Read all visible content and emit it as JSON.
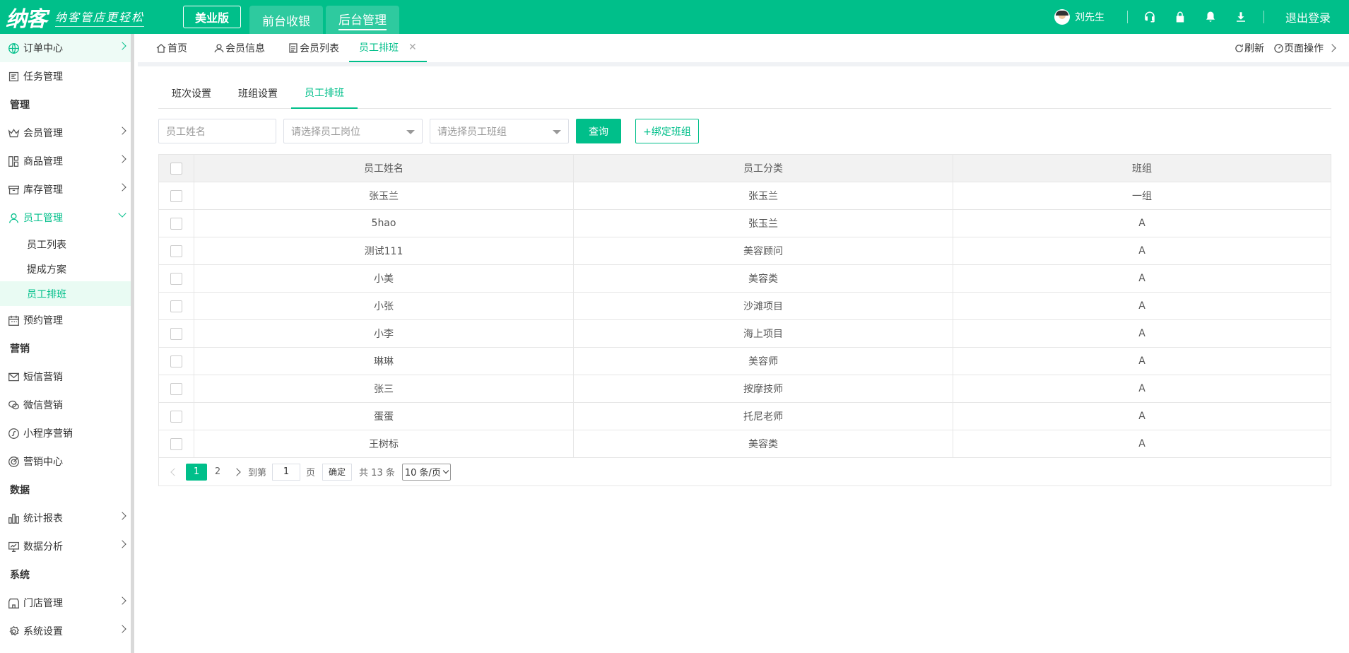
{
  "header": {
    "logo": "纳客",
    "slogan": "纳客管店更轻松",
    "edition": "美业版",
    "nav": [
      {
        "label": "前台收银"
      },
      {
        "label": "后台管理"
      }
    ],
    "user_name": "刘先生",
    "logout": "退出登录",
    "icons": [
      "headset-icon",
      "lock-icon",
      "bell-icon",
      "download-icon"
    ]
  },
  "sidebar": {
    "order_center": "订单中心",
    "task_mgmt": "任务管理",
    "group_manage": "管理",
    "member_mgmt": "会员管理",
    "goods_mgmt": "商品管理",
    "stock_mgmt": "库存管理",
    "staff_mgmt": "员工管理",
    "staff_list": "员工列表",
    "commission": "提成方案",
    "staff_schedule": "员工排班",
    "booking_mgmt": "预约管理",
    "group_marketing": "营销",
    "sms_marketing": "短信营销",
    "wechat_marketing": "微信营销",
    "miniapp_marketing": "小程序营销",
    "marketing_center": "营销中心",
    "group_data": "数据",
    "stat_report": "统计报表",
    "data_analysis": "数据分析",
    "group_system": "系统",
    "store_mgmt": "门店管理",
    "system_settings": "系统设置"
  },
  "tabs": {
    "home": "首页",
    "member_info": "会员信息",
    "member_list": "会员列表",
    "staff_schedule": "员工排班",
    "close": "✕",
    "refresh": "刷新",
    "page_ops": "页面操作"
  },
  "subtabs": {
    "shift_setting": "班次设置",
    "group_setting": "班组设置",
    "staff_schedule": "员工排班"
  },
  "filters": {
    "name_placeholder": "员工姓名",
    "post_placeholder": "请选择员工岗位",
    "group_placeholder": "请选择员工班组",
    "query": "查询",
    "bind_group": "+绑定班组"
  },
  "table": {
    "headers": [
      "员工姓名",
      "员工分类",
      "班组"
    ],
    "rows": [
      [
        "张玉兰",
        "张玉兰",
        "一组"
      ],
      [
        "5hao",
        "张玉兰",
        "A"
      ],
      [
        "测试111",
        "美容顾问",
        "A"
      ],
      [
        "小美",
        "美容类",
        "A"
      ],
      [
        "小张",
        "沙滩项目",
        "A"
      ],
      [
        "小李",
        "海上项目",
        "A"
      ],
      [
        "琳琳",
        "美容师",
        "A"
      ],
      [
        "张三",
        "按摩技师",
        "A"
      ],
      [
        "蛋蛋",
        "托尼老师",
        "A"
      ],
      [
        "王树标",
        "美容类",
        "A"
      ]
    ]
  },
  "pager": {
    "pages": [
      "1",
      "2"
    ],
    "goto_label": "到第",
    "goto_value": "1",
    "page_unit": "页",
    "confirm": "确定",
    "total": "共 13 条",
    "page_size": "10 条/页"
  },
  "colors": {
    "primary": "#00bf8a"
  }
}
